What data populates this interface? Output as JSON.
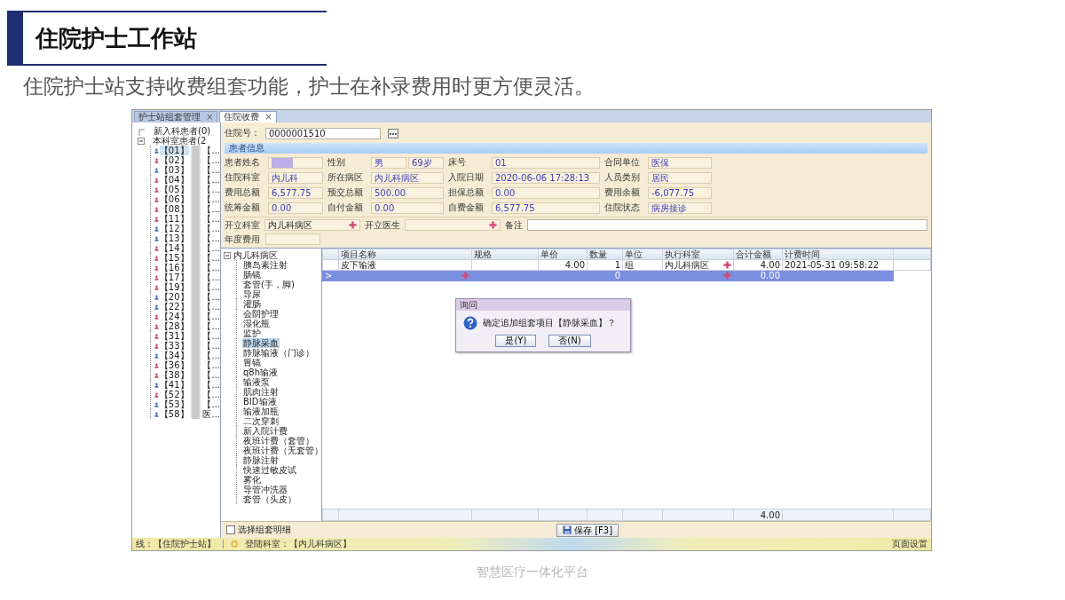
{
  "slide": {
    "title": "住院护士工作站",
    "subtitle": "住院护士站支持收费组套功能，护士在补录费用时更方便灵活。",
    "footer": "智慧医疗一体化平台"
  },
  "tabs": [
    {
      "label": "护士站组套管理",
      "close": "×",
      "selected": false
    },
    {
      "label": "住院收费",
      "close": "×",
      "selected": true
    }
  ],
  "new_patients": {
    "label": "新入科患者(0)"
  },
  "ward_patients": {
    "label": "本科室患者(2",
    "expanded": true,
    "children": [
      {
        "bed": "【01】",
        "suffix": "【...",
        "color": "#3a6fc4",
        "selected": true
      },
      {
        "bed": "【02】",
        "suffix": "【...",
        "color": "#d0406a",
        "selected": false
      },
      {
        "bed": "【03】",
        "suffix": "【...",
        "color": "#3a6fc4",
        "selected": false
      },
      {
        "bed": "【04】",
        "suffix": "【...",
        "color": "#d0406a",
        "selected": false
      },
      {
        "bed": "【05】",
        "suffix": "【...",
        "color": "#d0406a",
        "selected": false
      },
      {
        "bed": "【06】",
        "suffix": "【...",
        "color": "#d0406a",
        "selected": false
      },
      {
        "bed": "【08】",
        "suffix": "【...",
        "color": "#d0406a",
        "selected": false
      },
      {
        "bed": "【11】",
        "suffix": "【...",
        "color": "#d0406a",
        "selected": false
      },
      {
        "bed": "【12】",
        "suffix": "【...",
        "color": "#3a6fc4",
        "selected": false
      },
      {
        "bed": "【13】",
        "suffix": "【...",
        "color": "#3a6fc4",
        "selected": false
      },
      {
        "bed": "【14】",
        "suffix": "【...",
        "color": "#d0406a",
        "selected": false
      },
      {
        "bed": "【15】",
        "suffix": "【...",
        "color": "#d0406a",
        "selected": false
      },
      {
        "bed": "【16】",
        "suffix": "【...",
        "color": "#d0406a",
        "selected": false
      },
      {
        "bed": "【17】",
        "suffix": "【...",
        "color": "#d0406a",
        "selected": false
      },
      {
        "bed": "【19】",
        "suffix": "【...",
        "color": "#d0406a",
        "selected": false
      },
      {
        "bed": "【20】",
        "suffix": "【...",
        "color": "#3a6fc4",
        "selected": false
      },
      {
        "bed": "【22】",
        "suffix": "【...",
        "color": "#3a6fc4",
        "selected": false
      },
      {
        "bed": "【24】",
        "suffix": "【...",
        "color": "#d0406a",
        "selected": false
      },
      {
        "bed": "【28】",
        "suffix": "【...",
        "color": "#d0406a",
        "selected": false
      },
      {
        "bed": "【31】",
        "suffix": "【...",
        "color": "#d0406a",
        "selected": false
      },
      {
        "bed": "【33】",
        "suffix": "【...",
        "color": "#d0406a",
        "selected": false
      },
      {
        "bed": "【34】",
        "suffix": "【...",
        "color": "#3a6fc4",
        "selected": false
      },
      {
        "bed": "【36】",
        "suffix": "【...",
        "color": "#d0406a",
        "selected": false
      },
      {
        "bed": "【38】",
        "suffix": "【...",
        "color": "#d0406a",
        "selected": false
      },
      {
        "bed": "【41】",
        "suffix": "【...",
        "color": "#3a6fc4",
        "selected": false
      },
      {
        "bed": "【52】",
        "suffix": "【...",
        "color": "#d0406a",
        "selected": false
      },
      {
        "bed": "【53】",
        "suffix": "【...",
        "color": "#3a6fc4",
        "selected": false
      },
      {
        "bed": "【58】",
        "suffix": "医...",
        "color": "#3a6fc4",
        "selected": false
      }
    ]
  },
  "inpatient_no": {
    "label": "住院号：",
    "value": "0000001510"
  },
  "section_title": "患者信息",
  "info_rows": [
    {
      "cells": [
        {
          "label": "患者姓名",
          "kind": "redacted"
        },
        {
          "label": "性别",
          "kind": "pair",
          "value": "男",
          "value2": "69岁"
        },
        {
          "label": "床号",
          "kind": "text",
          "value": "01"
        },
        {
          "label": "合同单位",
          "kind": "text",
          "value": "医保"
        }
      ]
    },
    {
      "cells": [
        {
          "label": "住院科室",
          "kind": "text",
          "value": "内儿科"
        },
        {
          "label": "所在病区",
          "kind": "text",
          "value": "内儿科病区"
        },
        {
          "label": "入院日期",
          "kind": "text",
          "value": "2020-06-06 17:28:13"
        },
        {
          "label": "人员类别",
          "kind": "text",
          "value": "居民"
        }
      ]
    },
    {
      "cells": [
        {
          "label": "费用总额",
          "kind": "text",
          "value": "6,577.75"
        },
        {
          "label": "预交总额",
          "kind": "text",
          "value": "500.00"
        },
        {
          "label": "担保总额",
          "kind": "text",
          "value": "0.00"
        },
        {
          "label": "费用余额",
          "kind": "text",
          "value": "-6,077.75"
        }
      ]
    },
    {
      "cells": [
        {
          "label": "统筹金额",
          "kind": "text",
          "value": "0.00"
        },
        {
          "label": "自付金额",
          "kind": "text",
          "value": "0.00"
        },
        {
          "label": "自费金额",
          "kind": "text",
          "value": "6,577.75"
        },
        {
          "label": "住院状态",
          "kind": "text",
          "value": "病房接诊"
        }
      ]
    }
  ],
  "order_row": [
    {
      "label": "开立科室",
      "kind": "picker",
      "value": "内儿科病区"
    },
    {
      "label": "开立医生",
      "kind": "picker"
    },
    {
      "label": "备注",
      "kind": "wide"
    }
  ],
  "annual_fee": {
    "label": "年度费用"
  },
  "item_tree": {
    "root": "内儿科病区",
    "expanded": true,
    "children": [
      {
        "label": "胰岛素注射",
        "selected": false
      },
      {
        "label": "肠镜",
        "selected": false
      },
      {
        "label": "套管(手，脚)",
        "selected": false
      },
      {
        "label": "导尿",
        "selected": false
      },
      {
        "label": "灌肠",
        "selected": false
      },
      {
        "label": "会阴护理",
        "selected": false
      },
      {
        "label": "湿化瓶",
        "selected": false
      },
      {
        "label": "监护",
        "selected": false
      },
      {
        "label": "静脉采血",
        "selected": true
      },
      {
        "label": "静脉输液（门诊）",
        "selected": false
      },
      {
        "label": "胃镜",
        "selected": false
      },
      {
        "label": "q8h输液",
        "selected": false
      },
      {
        "label": "输液泵",
        "selected": false
      },
      {
        "label": "肌肉注射",
        "selected": false
      },
      {
        "label": "BID输液",
        "selected": false
      },
      {
        "label": "输液加瓶",
        "selected": false
      },
      {
        "label": "二次穿刺",
        "selected": false
      },
      {
        "label": "新入院计费",
        "selected": false
      },
      {
        "label": "夜班计费（套管）",
        "selected": false
      },
      {
        "label": "夜班计费（无套管）",
        "selected": false
      },
      {
        "label": "静脉注射",
        "selected": false
      },
      {
        "label": "快速过敏皮试",
        "selected": false
      },
      {
        "label": "雾化",
        "selected": false
      },
      {
        "label": "导管冲洗器",
        "selected": false
      },
      {
        "label": "套管（头皮）",
        "selected": false
      }
    ]
  },
  "grid": {
    "columns": [
      "项目名称",
      "规格",
      "单价",
      "数量",
      "单位",
      "执行科室",
      "合计金额",
      "计费时间"
    ],
    "rows": [
      {
        "selected": false,
        "editing": false,
        "name": "皮下输液",
        "price": "4.00",
        "qty": "1",
        "unit": "组",
        "dept": "内儿科病区",
        "amount": "4.00",
        "time": "2021-05-31 09:58:22"
      },
      {
        "selected": true,
        "editing": true,
        "indicator": ">",
        "qty": "0",
        "amount": "0.00"
      }
    ],
    "total": "4.00"
  },
  "dialog": {
    "title": "询问",
    "message": "确定追加组套项目【静脉采血】？",
    "buttons": [
      "是(Y)",
      "否(N)"
    ]
  },
  "detail_checkbox": {
    "label": "选择组套明细",
    "checked": false
  },
  "save_button": "保存 [F3]",
  "status_bar": {
    "items": [
      "线：【住院护士站】",
      "登陆科室：【内儿科病区】"
    ],
    "right": "页面设置"
  }
}
